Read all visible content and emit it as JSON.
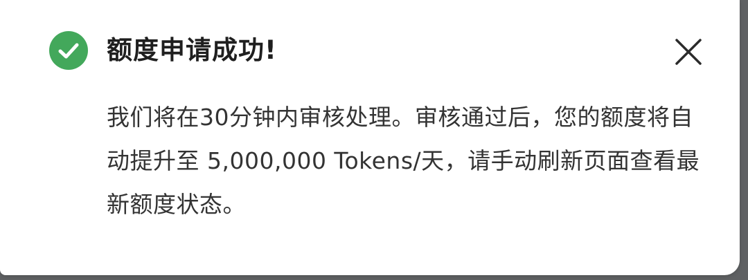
{
  "dialog": {
    "title": "额度申请成功!",
    "message": "我们将在30分钟内审核处理。审核通过后，您的额度将自动提升至 5,000,000 Tokens/天，请手动刷新页面查看最新额度状态。",
    "success_icon": "check-circle-icon",
    "close_icon": "close-icon",
    "colors": {
      "success": "#43a85b",
      "title_text": "#1f1f1f",
      "body_text": "#333333",
      "backdrop": "#5f6163"
    }
  }
}
